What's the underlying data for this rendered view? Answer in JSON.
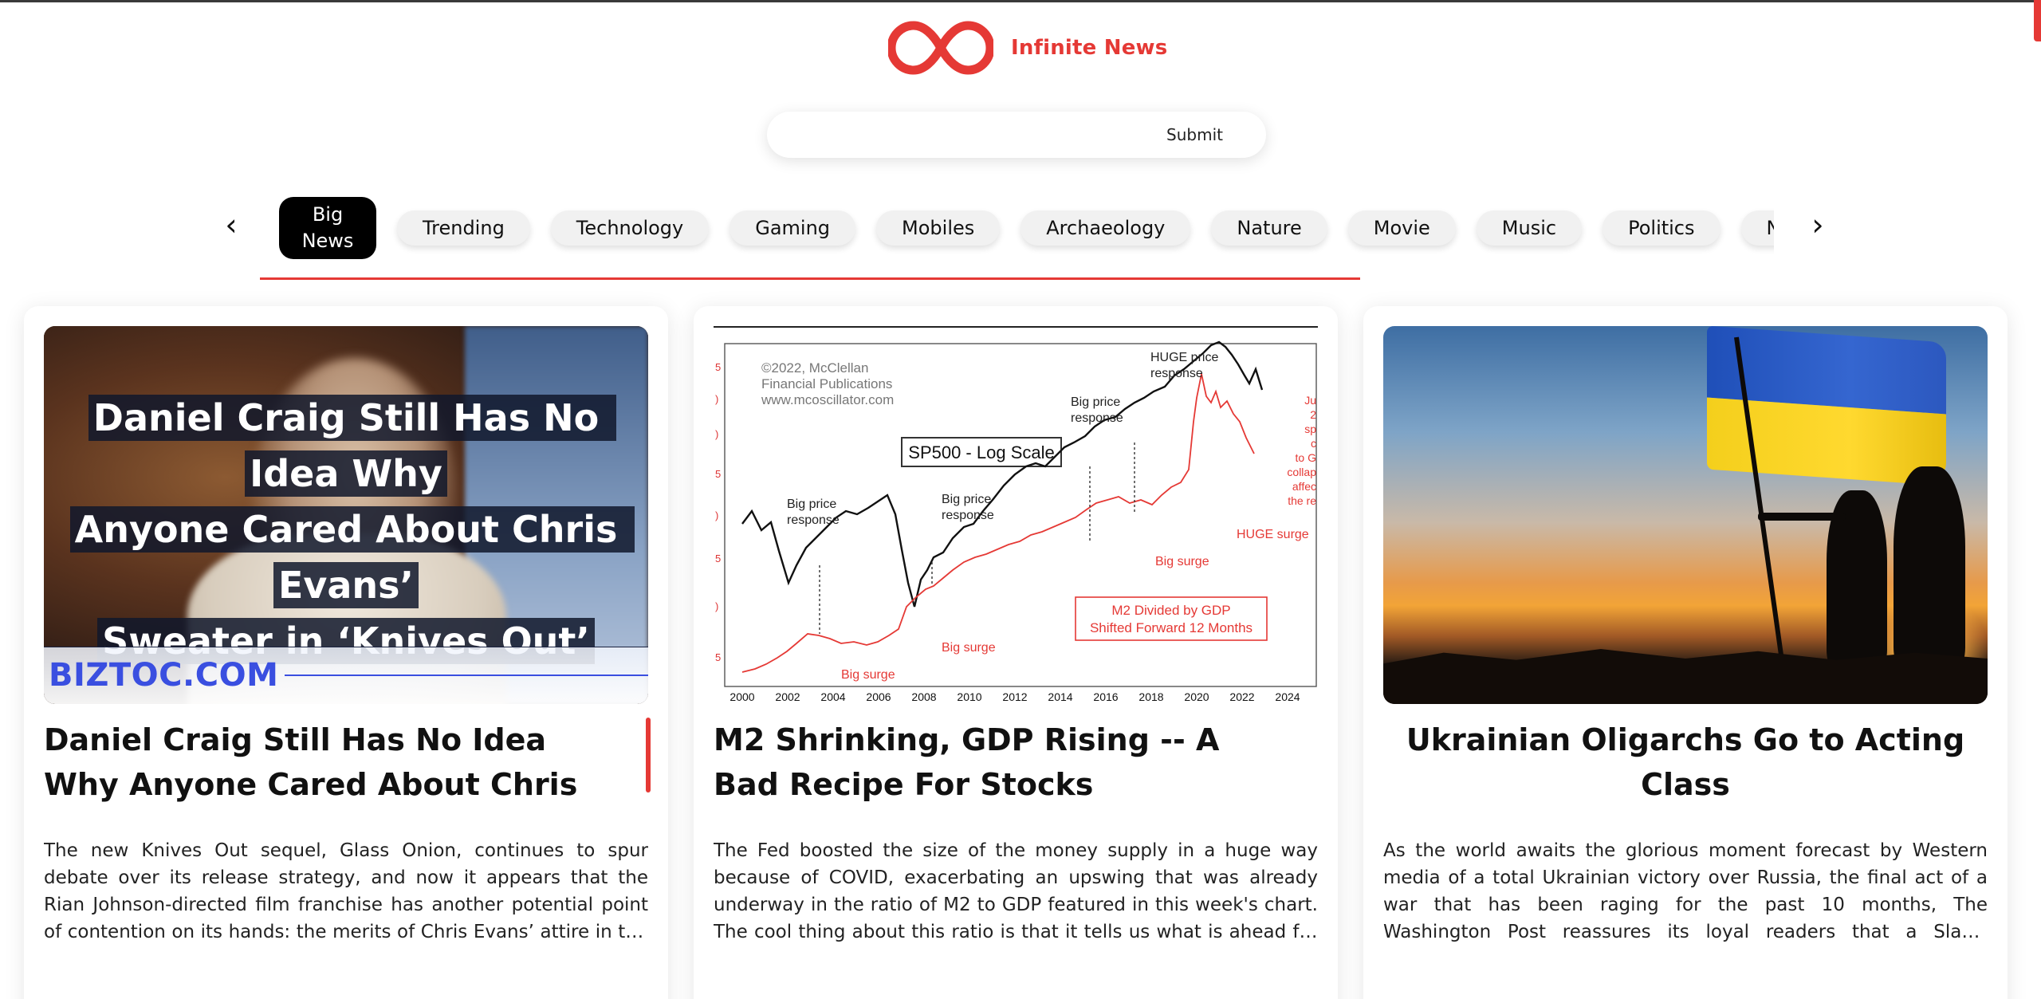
{
  "header": {
    "brand_name": "Infinite News",
    "logo_icon": "infinity-icon",
    "accent_color": "#e53935"
  },
  "search": {
    "placeholder": "",
    "value": "",
    "submit_label": "Submit"
  },
  "categories": {
    "prev_icon": "chevron-left-icon",
    "next_icon": "chevron-right-icon",
    "active": "Big News",
    "items": [
      "Big News",
      "Trending",
      "Technology",
      "Gaming",
      "Mobiles",
      "Archaeology",
      "Nature",
      "Movie",
      "Music",
      "Politics",
      "National"
    ]
  },
  "articles": [
    {
      "image": {
        "overlay_lines": [
          "Daniel Craig Still Has No Idea Why",
          "Anyone Cared About Chris Evans’",
          "Sweater in ‘Knives Out’"
        ],
        "source_label": "BIZTOC.COM"
      },
      "title": "Daniel Craig Still Has No Idea Why Anyone Cared About Chris Evans’ Sweater in ‘Knives Out’",
      "description": "The new Knives Out sequel, Glass Onion, continues to spur debate over its release strategy, and now it appears that the Rian Johnson-directed film franchise has another potential point of contention on its hands: the merits of Chris Evans’ attire in the first..."
    },
    {
      "image": {
        "chart_box_label": "SP500 - Log Scale",
        "copyright": [
          "©2022, McClellan",
          "Financial Publications",
          "www.mcoscillator.com"
        ],
        "legend_box": [
          "M2 Divided by GDP",
          "Shifted Forward 12 Months"
        ],
        "annotations": {
          "price_2004": [
            "Big price",
            "response"
          ],
          "price_2009": [
            "Big price",
            "response"
          ],
          "price_2016": [
            "Big price",
            "response"
          ],
          "price_2020": [
            "HUGE price",
            "response"
          ],
          "surge_2004": "Big surge",
          "surge_2010": "Big surge",
          "surge_2018": "Big surge",
          "surge_2021": "HUGE surge",
          "right_note": [
            "Ju",
            "2",
            "sp",
            "c",
            "to G",
            "collap",
            "affec",
            "the re"
          ]
        },
        "x_ticks": [
          "2000",
          "2002",
          "2004",
          "2006",
          "2008",
          "2010",
          "2012",
          "2014",
          "2016",
          "2018",
          "2020",
          "2022",
          "2024"
        ]
      },
      "title": "M2 Shrinking, GDP Rising -- A Bad Recipe For Stocks",
      "description": "The Fed boosted the size of the money supply in a huge way because of COVID, exacerbating an upswing that was already underway in the ratio of M2 to GDP featured in this week's chart. The cool thing about this ratio is that it tells us what is ahead for the s..."
    },
    {
      "image": {},
      "title": "Ukrainian Oligarchs Go to Acting Class",
      "description": "As the world awaits the glorious moment forecast by Western media of a total Ukrainian victory over Russia, the final act of a war that has been raging for the past 10 months, The Washington Post reassures its loyal readers that a Slavic neoliberal Utopia is ..."
    }
  ]
}
